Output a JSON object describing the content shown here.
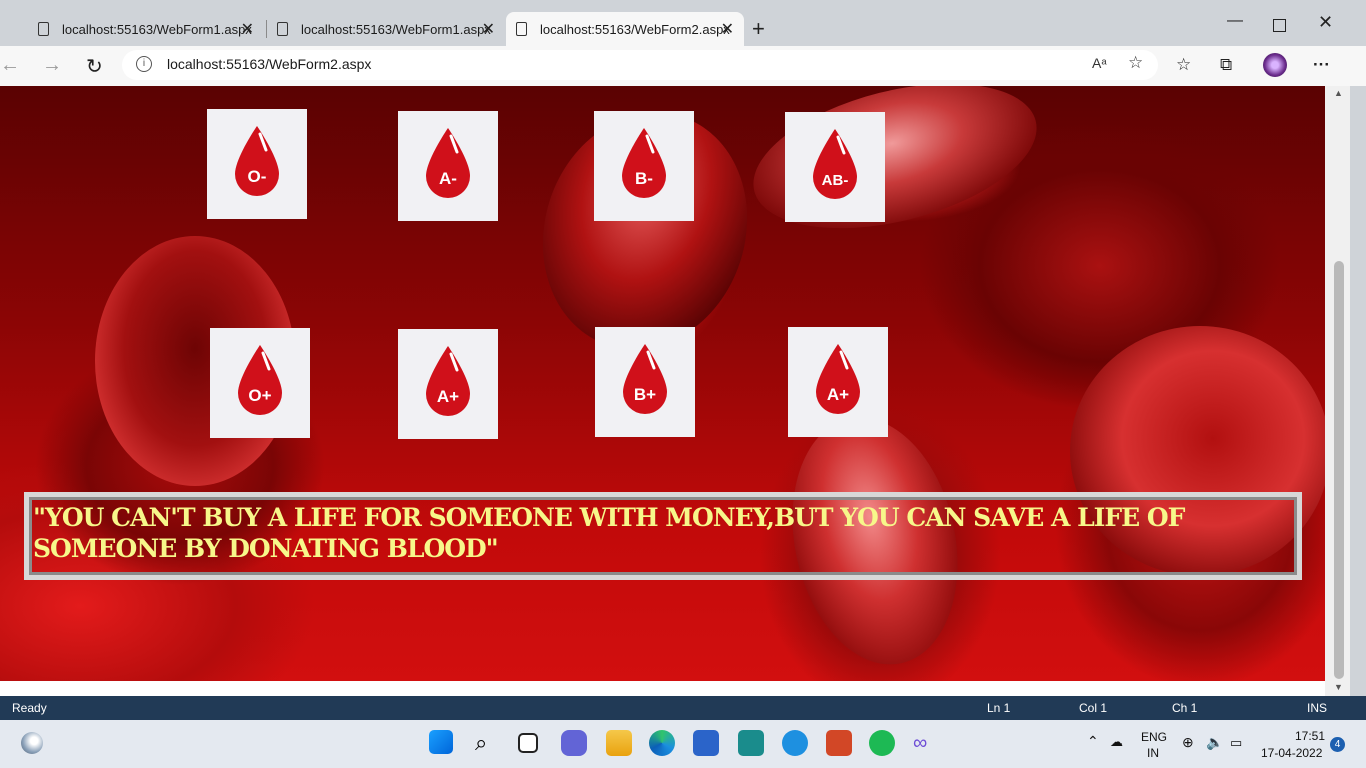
{
  "browser": {
    "tabs": [
      {
        "title": "localhost:55163/WebForm1.aspx"
      },
      {
        "title": "localhost:55163/WebForm1.aspx"
      },
      {
        "title": "localhost:55163/WebForm2.aspx",
        "active": true
      }
    ],
    "address": "localhost:55163/WebForm2.aspx",
    "read_aloud": "Aᵃ"
  },
  "page": {
    "blood_groups_row1": [
      "O-",
      "A-",
      "B-",
      "AB-"
    ],
    "blood_groups_row2": [
      "O+",
      "A+",
      "B+",
      "A+"
    ],
    "quote": "\"YOU CAN'T BUY A LIFE FOR SOMEONE WITH MONEY,BUT YOU CAN SAVE A LIFE OF SOMEONE BY DONATING BLOOD\"",
    "colors": {
      "drop": "#d0101a",
      "quote_text": "#f7f78a",
      "background": "#b00a0a"
    }
  },
  "statusbar": {
    "state": "Ready",
    "ln": "Ln 1",
    "col": "Col 1",
    "ch": "Ch 1",
    "mode": "INS"
  },
  "taskbar": {
    "lang_line1": "ENG",
    "lang_line2": "IN",
    "time": "17:51",
    "date": "17-04-2022",
    "notifications": "4"
  }
}
